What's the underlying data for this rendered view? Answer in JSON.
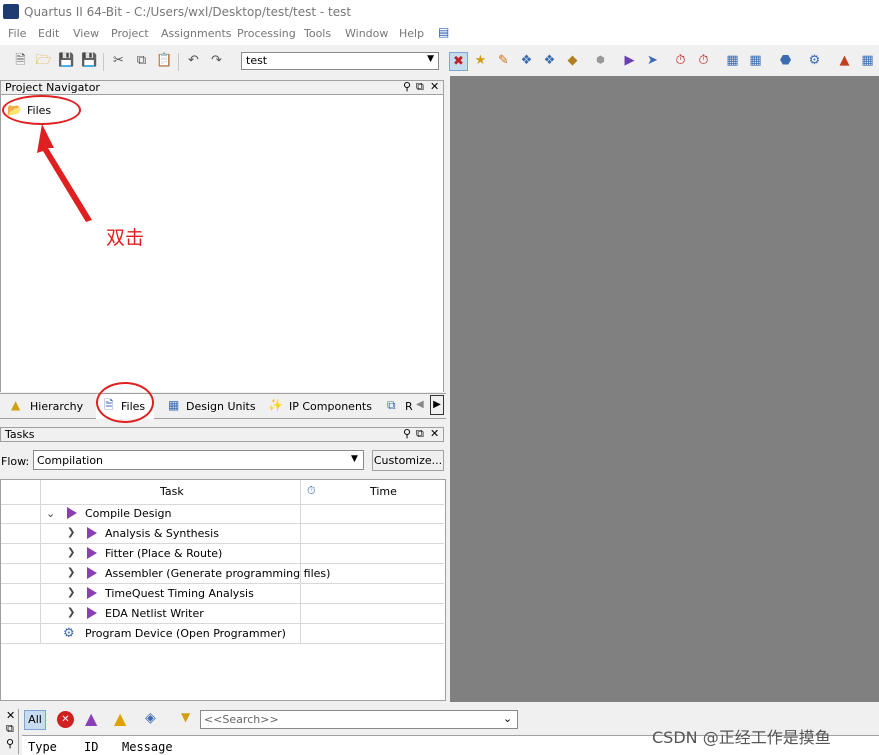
{
  "window": {
    "title": "Quartus II 64-Bit - C:/Users/wxl/Desktop/test/test - test"
  },
  "menu": [
    "File",
    "Edit",
    "View",
    "Project",
    "Assignments",
    "Processing",
    "Tools",
    "Window",
    "Help"
  ],
  "toolbar": {
    "project_value": "test"
  },
  "navigator": {
    "title": "Project Navigator",
    "root_item": "Files",
    "tabs": [
      "Hierarchy",
      "Files",
      "Design Units",
      "IP Components",
      "R"
    ]
  },
  "annotation": {
    "text": "双击"
  },
  "tasks": {
    "title": "Tasks",
    "flow_label": "Flow:",
    "flow_value": "Compilation",
    "customize": "Customize...",
    "columns": {
      "task": "Task",
      "time": "Time"
    },
    "rows": [
      "Compile Design",
      "Analysis & Synthesis",
      "Fitter (Place & Route)",
      "Assembler (Generate programming files)",
      "TimeQuest Timing Analysis",
      "EDA Netlist Writer",
      "Program Device (Open Programmer)"
    ]
  },
  "messages": {
    "all": "All",
    "search_placeholder": "<<Search>>",
    "columns": [
      "Type",
      "ID",
      "Message"
    ]
  },
  "watermark": "CSDN @正经工作是摸鱼",
  "colors": {
    "mdi": "#808080",
    "annotation": "#e02020",
    "task_icon": "#8b3fb5"
  }
}
